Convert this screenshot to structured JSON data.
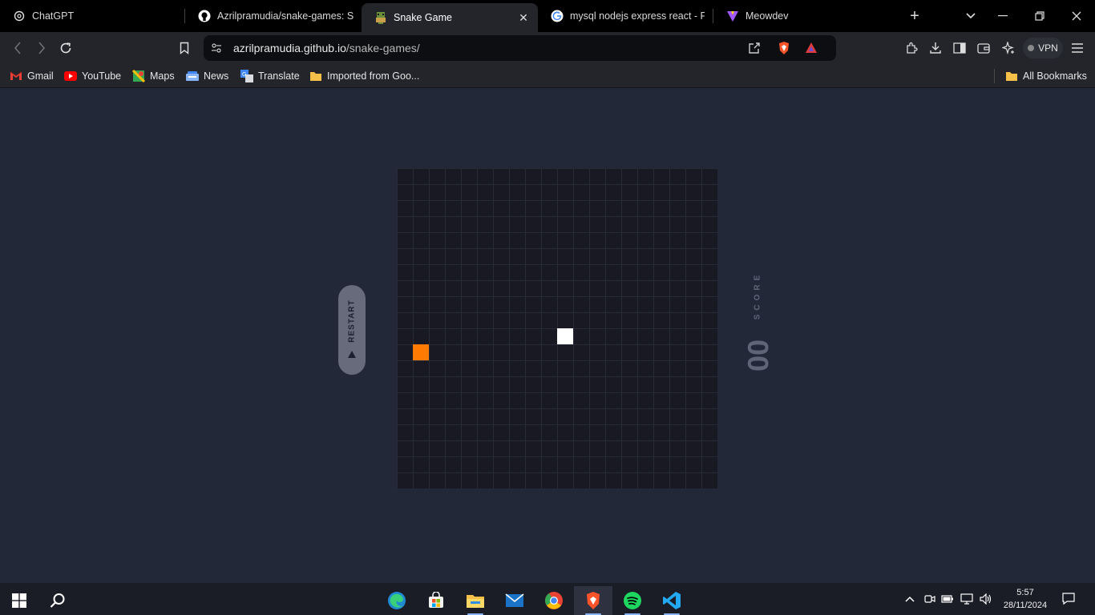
{
  "tabs": [
    {
      "title": "ChatGPT",
      "icon": "chatgpt-icon"
    },
    {
      "title": "Azrilpramudia/snake-games: Snake",
      "icon": "github-icon"
    },
    {
      "title": "Snake Game",
      "icon": "snake-favicon",
      "active": true
    },
    {
      "title": "mysql nodejs express react - Penelusuran",
      "icon": "google-icon"
    },
    {
      "title": "Meowdev",
      "icon": "meowdev-icon"
    }
  ],
  "address": {
    "host": "azrilpramudia.github.io",
    "path": "/snake-games/"
  },
  "vpn_label": "VPN",
  "bookmarks": [
    {
      "label": "Gmail",
      "icon": "gmail-icon"
    },
    {
      "label": "YouTube",
      "icon": "youtube-icon"
    },
    {
      "label": "Maps",
      "icon": "maps-icon"
    },
    {
      "label": "News",
      "icon": "news-icon"
    },
    {
      "label": "Translate",
      "icon": "translate-icon"
    },
    {
      "label": "Imported from Goo...",
      "icon": "folder-icon"
    }
  ],
  "all_bookmarks": "All Bookmarks",
  "game": {
    "restart_label": "RESTART",
    "score_label": "SCORE",
    "score_value": "00",
    "food_color": "#ff7a00",
    "snake_color": "#ffffff"
  },
  "clock": {
    "time": "5:57",
    "date": "28/11/2024"
  }
}
